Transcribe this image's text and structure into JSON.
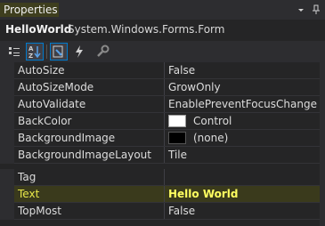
{
  "panel": {
    "title": "Properties",
    "dropdown_icon": "chevron-down-icon",
    "pin_icon": "pin-icon"
  },
  "object": {
    "name": "HelloWorld",
    "type": "System.Windows.Forms.Form"
  },
  "toolbar": {
    "buttons": [
      {
        "icon": "categorized-icon",
        "active": false
      },
      {
        "icon": "alphabetical-icon",
        "active": true
      },
      {
        "icon": "properties-icon",
        "active": true
      },
      {
        "icon": "events-icon",
        "active": false
      },
      {
        "icon": "property-pages-icon",
        "active": false
      }
    ]
  },
  "properties": [
    {
      "name": "AutoSize",
      "value": "False"
    },
    {
      "name": "AutoSizeMode",
      "value": "GrowOnly"
    },
    {
      "name": "AutoValidate",
      "value": "EnablePreventFocusChange"
    },
    {
      "name": "BackColor",
      "value": "Control",
      "swatch": "#ffffff"
    },
    {
      "name": "BackgroundImage",
      "value": "(none)",
      "swatch": "#000000"
    },
    {
      "name": "BackgroundImageLayout",
      "value": "Tile"
    },
    {
      "name": "Tag",
      "value": ""
    },
    {
      "name": "Text",
      "value": "Hello World",
      "selected": true
    },
    {
      "name": "TopMost",
      "value": "False"
    }
  ],
  "colors": {
    "background": "#252526",
    "highlight_text": "#ffff60",
    "accent": "#007acc"
  }
}
